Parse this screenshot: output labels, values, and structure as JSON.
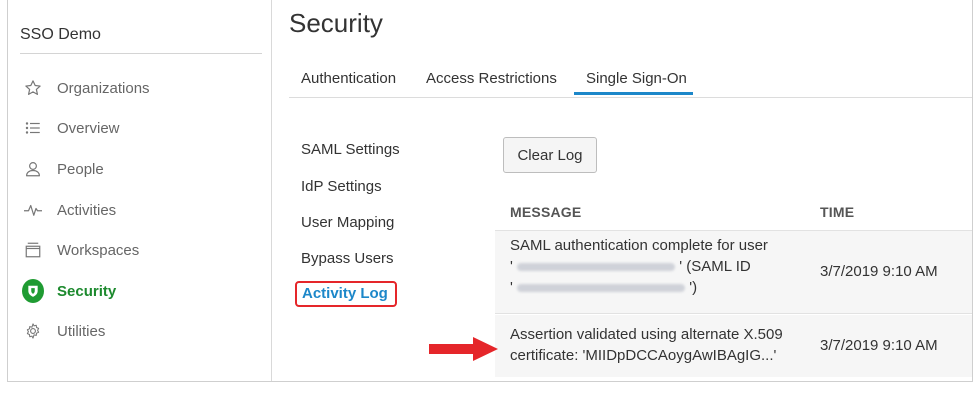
{
  "sidebar": {
    "org_name": "SSO Demo",
    "items": [
      {
        "label": "Organizations",
        "icon": "star-icon"
      },
      {
        "label": "Overview",
        "icon": "list-icon"
      },
      {
        "label": "People",
        "icon": "person-icon"
      },
      {
        "label": "Activities",
        "icon": "pulse-icon"
      },
      {
        "label": "Workspaces",
        "icon": "workspace-icon"
      },
      {
        "label": "Security",
        "icon": "shield-icon",
        "active": true,
        "color": "#1f9b32"
      },
      {
        "label": "Utilities",
        "icon": "gear-icon"
      }
    ]
  },
  "page": {
    "title": "Security"
  },
  "tabs": [
    {
      "label": "Authentication"
    },
    {
      "label": "Access Restrictions"
    },
    {
      "label": "Single Sign-On",
      "active": true
    }
  ],
  "subnav": [
    {
      "label": "SAML Settings"
    },
    {
      "label": "IdP Settings"
    },
    {
      "label": "User Mapping"
    },
    {
      "label": "Bypass Users"
    },
    {
      "label": "Activity Log",
      "active": true
    }
  ],
  "log": {
    "clear_label": "Clear Log",
    "columns": {
      "message": "MESSAGE",
      "time": "TIME"
    },
    "rows": [
      {
        "line1": "SAML authentication complete for user",
        "line2_prefix": "'",
        "line2_suffix": "' (SAML ID",
        "line3_prefix": "'",
        "line3_suffix": "')",
        "time": "3/7/2019 9:10 AM"
      },
      {
        "line1": "Assertion validated using alternate X.509",
        "line2": "certificate: 'MIIDpDCCAoygAwIBAgIG...'",
        "time": "3/7/2019 9:10 AM"
      }
    ]
  },
  "colors": {
    "accent": "#1c87c9",
    "highlight": "#e5262a",
    "active": "#1d8a2e"
  }
}
